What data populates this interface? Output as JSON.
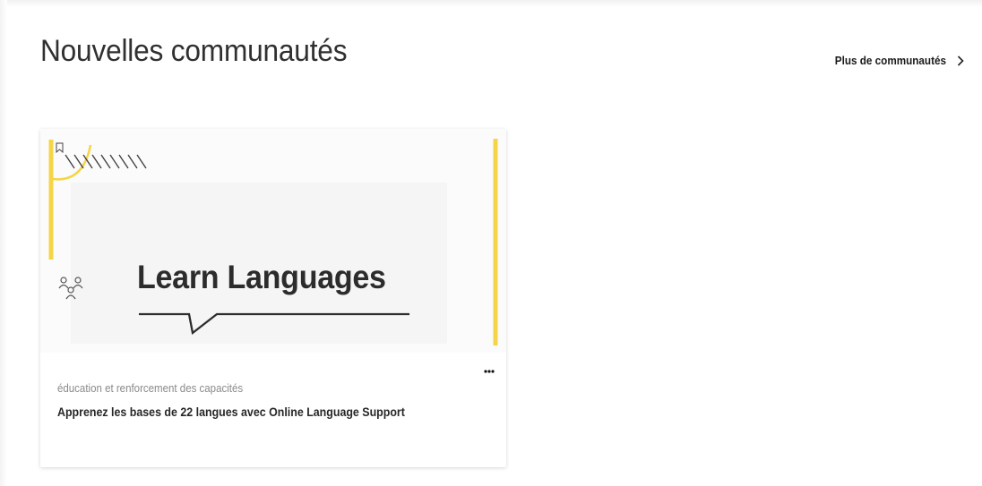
{
  "section": {
    "title": "Nouvelles communautés",
    "more_link_label": "Plus de communautés"
  },
  "card": {
    "banner_text": "Learn Languages",
    "category": "éducation et renforcement des capacités",
    "title": "Apprenez les bases de 22 langues avec Online Language Support",
    "accent_color": "#f5d547",
    "icons": {
      "bookmark": "bookmark-icon",
      "members": "members-icon",
      "more": "more-options-icon"
    }
  }
}
